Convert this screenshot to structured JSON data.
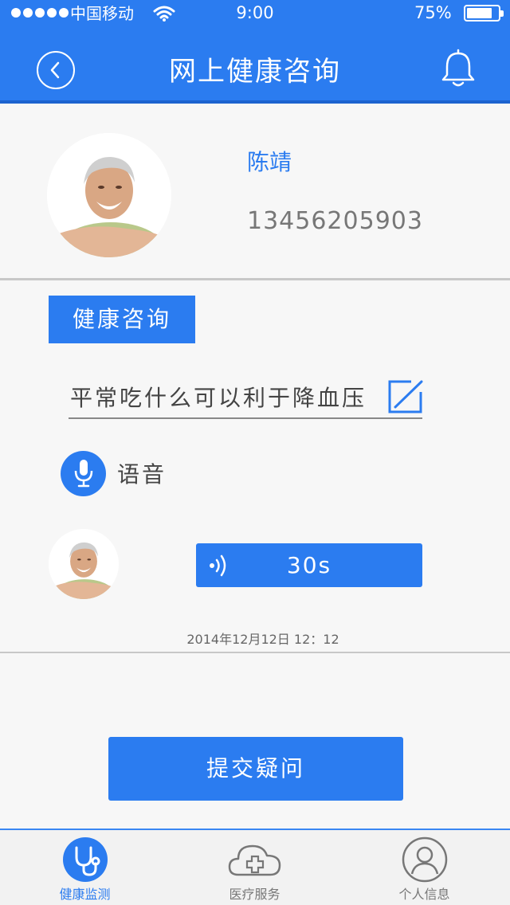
{
  "status_bar": {
    "carrier": "中国移动",
    "time": "9:00",
    "battery": "75%",
    "battery_level": 0.75
  },
  "header": {
    "title": "网上健康咨询",
    "back_icon": "back-arrow-icon",
    "bell_icon": "bell-icon"
  },
  "profile": {
    "name": "陈靖",
    "phone": "13456205903"
  },
  "consult": {
    "section_label": "健康咨询",
    "question": "平常吃什么可以利于降血压",
    "voice_label": "语音",
    "voice_message": {
      "duration": "30s"
    },
    "timestamp": "2014年12月12日    12：12"
  },
  "submit_label": "提交疑问",
  "tab_bar": {
    "tabs": [
      {
        "label": "健康监测",
        "icon": "stethoscope-icon",
        "active": true
      },
      {
        "label": "医疗服务",
        "icon": "medical-cloud-icon",
        "active": false
      },
      {
        "label": "个人信息",
        "icon": "user-icon",
        "active": false
      }
    ]
  },
  "colors": {
    "primary": "#2b7cf0",
    "header_shadow": "#1c63cf",
    "background": "#f7f7f7",
    "text_gray": "#777777"
  }
}
